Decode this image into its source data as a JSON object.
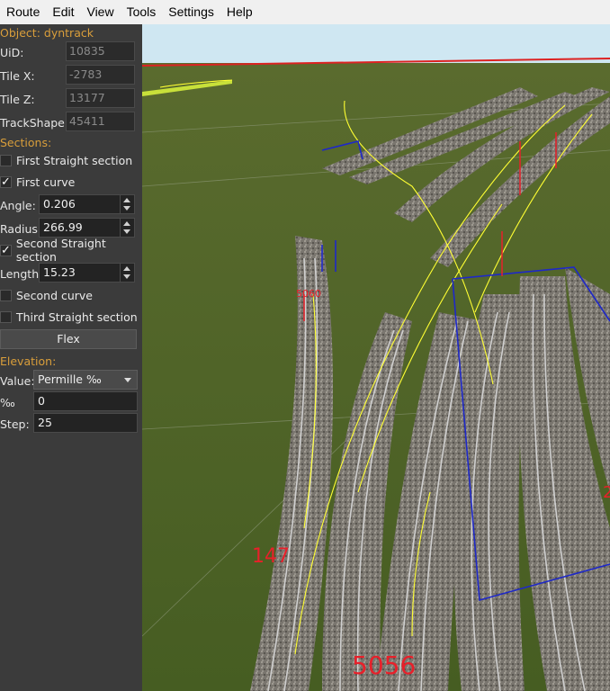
{
  "menu": [
    "Route",
    "Edit",
    "View",
    "Tools",
    "Settings",
    "Help"
  ],
  "panel": {
    "object_header": "Object: dyntrack",
    "uid_label": "UiD:",
    "uid_value": "10835",
    "tilex_label": "Tile X:",
    "tilex_value": "-2783",
    "tilez_label": "Tile Z:",
    "tilez_value": "13177",
    "trackshape_label": "TrackShape:",
    "trackshape_value": "45411",
    "sections_header": "Sections:",
    "first_straight": {
      "label": "First Straight section",
      "checked": false
    },
    "first_curve": {
      "label": "First curve",
      "checked": true
    },
    "angle_label": "Angle:",
    "angle_value": "0.206",
    "radius_label": "Radius:",
    "radius_value": "266.99",
    "second_straight": {
      "label": "Second Straight section",
      "checked": true
    },
    "length_label": "Length:",
    "length_value": "15.23",
    "second_curve": {
      "label": "Second curve",
      "checked": false
    },
    "third_straight": {
      "label": "Third Straight section",
      "checked": false
    },
    "flex_button": "Flex",
    "elevation_header": "Elevation:",
    "value_label": "Value:",
    "value_selected": "Permille ‰",
    "permille_label": "‰",
    "permille_value": "0",
    "step_label": "Step:",
    "step_value": "25"
  },
  "viewport": {
    "labels": [
      "147",
      "5056",
      "5060",
      "2"
    ],
    "colors": {
      "sky": "#cfe7f2",
      "grass": "#4f6526",
      "ballast": "#77736c",
      "rail": "#c9c9c9",
      "yellow_line": "#ffff33",
      "blue_box": "#1e28c8",
      "red_label": "#e8202a"
    }
  }
}
